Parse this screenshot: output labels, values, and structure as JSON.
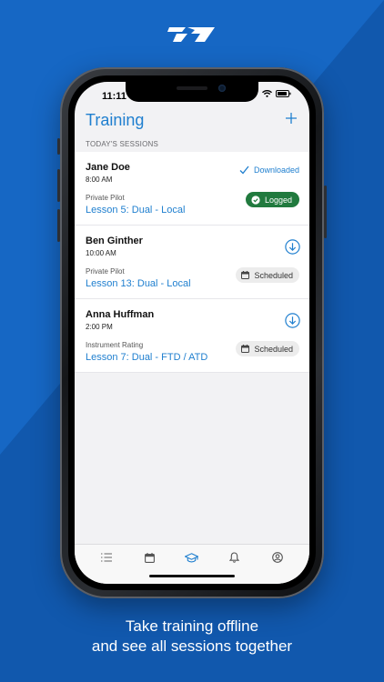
{
  "colors": {
    "background": "#1667c4",
    "accent": "#1f7fcf",
    "logged_badge": "#217a3e"
  },
  "status_bar": {
    "time": "11:11"
  },
  "nav": {
    "title": "Training",
    "add_icon": "plus-icon"
  },
  "section": {
    "label": "TODAY'S SESSIONS"
  },
  "sessions": [
    {
      "name": "Jane Doe",
      "time": "8:00 AM",
      "course": "Private Pilot",
      "lesson": "Lesson 5: Dual - Local",
      "download": "Downloaded",
      "status": "Logged"
    },
    {
      "name": "Ben Ginther",
      "time": "10:00 AM",
      "course": "Private Pilot",
      "lesson": "Lesson 13: Dual - Local",
      "status": "Scheduled"
    },
    {
      "name": "Anna Huffman",
      "time": "2:00 PM",
      "course": "Instrument Rating",
      "lesson": "Lesson 7: Dual - FTD / ATD",
      "status": "Scheduled"
    }
  ],
  "tabs": [
    {
      "icon": "list-icon",
      "active": false
    },
    {
      "icon": "calendar-icon",
      "active": false
    },
    {
      "icon": "graduation-cap-icon",
      "active": true
    },
    {
      "icon": "bell-icon",
      "active": false
    },
    {
      "icon": "profile-icon",
      "active": false
    }
  ],
  "caption": {
    "line1": "Take training offline",
    "line2": "and see all sessions together"
  }
}
